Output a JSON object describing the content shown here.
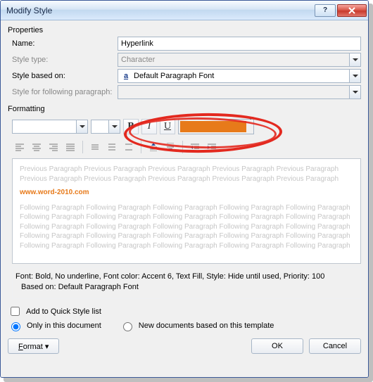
{
  "title": "Modify Style",
  "sections": {
    "properties": "Properties",
    "formatting": "Formatting"
  },
  "labels": {
    "name": "Name:",
    "style_type": "Style type:",
    "style_based_on": "Style based on:",
    "following": "Style for following paragraph:"
  },
  "values": {
    "name": "Hyperlink",
    "style_type": "Character",
    "based_on_prefix": "a",
    "based_on": "Default Paragraph Font"
  },
  "format_btn": {
    "B": "B",
    "I": "I",
    "U": "U"
  },
  "color": "#e77a1a",
  "preview": {
    "prev": "Previous Paragraph Previous Paragraph Previous Paragraph Previous Paragraph Previous Paragraph Previous Paragraph Previous Paragraph Previous Paragraph Previous Paragraph Previous Paragraph",
    "sample": "www.word-2010.com",
    "next": "Following Paragraph Following Paragraph Following Paragraph Following Paragraph Following Paragraph Following Paragraph Following Paragraph Following Paragraph Following Paragraph Following Paragraph Following Paragraph Following Paragraph Following Paragraph Following Paragraph Following Paragraph Following Paragraph Following Paragraph Following Paragraph Following Paragraph Following Paragraph Following Paragraph Following Paragraph Following Paragraph Following Paragraph Following Paragraph"
  },
  "description": {
    "line1": "Font: Bold, No underline, Font color: Accent 6, Text Fill, Style: Hide until used, Priority: 100",
    "line2": "Based on: Default Paragraph Font"
  },
  "options": {
    "quicklist": "Add to Quick Style list",
    "only_doc": "Only in this document",
    "new_docs": "New documents based on this template"
  },
  "buttons": {
    "format": "ormat",
    "format_u": "F",
    "ok": "OK",
    "cancel": "Cancel"
  }
}
